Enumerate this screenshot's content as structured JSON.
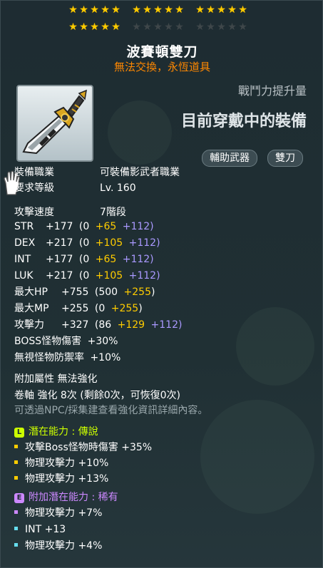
{
  "stars": {
    "row1": {
      "groups": [
        5,
        5,
        5
      ],
      "filled": 15
    },
    "row2": {
      "groups": [
        5,
        5,
        5
      ],
      "filled": 5
    }
  },
  "item": {
    "name": "波賽頓雙刀",
    "trade_note": "無法交換，永恆道具"
  },
  "header": {
    "power_label": "戰鬥力提升量",
    "equipped_label": "目前穿戴中的裝備",
    "tags": [
      "輔助武器",
      "雙刀"
    ]
  },
  "requirements": {
    "job_label": "裝備職業",
    "job_value": "可裝備影武者職業",
    "level_label": "要求等級",
    "level_value": "Lv. 160"
  },
  "stats": {
    "speed_label": "攻擊速度",
    "speed_value": "7階段",
    "rows": [
      {
        "label": "STR",
        "total": "+177",
        "open": "(0",
        "star": "+65",
        "flame": "+112)"
      },
      {
        "label": "DEX",
        "total": "+217",
        "open": "(0",
        "star": "+105",
        "flame": "+112)"
      },
      {
        "label": "INT",
        "total": "+177",
        "open": "(0",
        "star": "+65",
        "flame": "+112)"
      },
      {
        "label": "LUK",
        "total": "+217",
        "open": "(0",
        "star": "+105",
        "flame": "+112)"
      },
      {
        "label": "最大HP",
        "total": "+755",
        "open": "(500",
        "star": "+255",
        "flame": ")"
      },
      {
        "label": "最大MP",
        "total": "+255",
        "open": "(0",
        "star": "+255",
        "flame": ")"
      },
      {
        "label": "攻擊力",
        "total": "+327",
        "open": "(86",
        "star": "+129",
        "flame": "+112)"
      }
    ],
    "boss_label": "BOSS怪物傷害",
    "boss_value": "+30%",
    "ied_label": "無視怪物防禦率",
    "ied_value": "+10%"
  },
  "misc": {
    "extra_attr": "附加屬性 無法強化",
    "scroll": "卷軸 強化 8次 (剩餘0次，可恢復0次)",
    "npc_note": "可透過NPC/採集建查看強化資訊詳細內容。"
  },
  "potential": {
    "badge": "L",
    "label": "潛在能力 : 傳說",
    "color": "#ccff00",
    "lines": [
      "攻擊Boss怪物時傷害 +35%",
      "物理攻擊力 +10%",
      "物理攻擊力 +13%"
    ],
    "bullet_colors": [
      "#ffcc00",
      "#ffcc00",
      "#ffcc00"
    ]
  },
  "additional_potential": {
    "badge": "E",
    "label": "附加潛在能力 : 稀有",
    "color": "#cc88ff",
    "lines": [
      "物理攻擊力 +7%",
      "INT +13",
      "物理攻擊力 +4%"
    ],
    "bullet_colors": [
      "#cc88ff",
      "#66ddee",
      "#66ddee"
    ]
  },
  "icons": {
    "item_icon": "dual-blade-icon",
    "cursor": "glove-cursor-icon"
  }
}
